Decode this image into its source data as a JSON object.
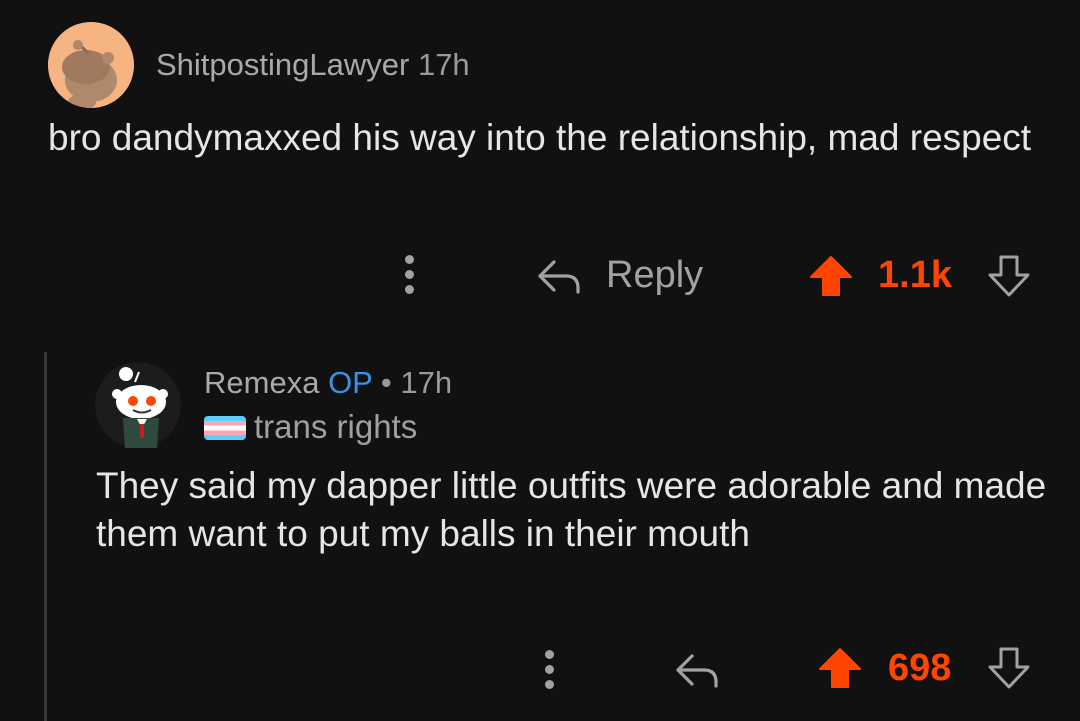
{
  "comments": [
    {
      "username": "ShitpostingLawyer",
      "time": "17h",
      "body": "bro dandymaxxed his way into the relationship, mad respect",
      "reply_label": "Reply",
      "score": "1.1k",
      "avatar_icon": "snoo-avatar-orange"
    },
    {
      "username": "Remexa",
      "op_badge": "OP",
      "separator": "•",
      "time": "17h",
      "flair": "trans rights",
      "flair_icon": "trans-flag-icon",
      "body": "They said my dapper little outfits were adorable and made them want to put my balls in their mouth",
      "score": "698",
      "avatar_icon": "snoo-avatar-dark"
    }
  ],
  "colors": {
    "background": "#111112",
    "upvote_active": "#ff4500",
    "op_badge": "#3a91e8",
    "muted_text": "#9a9a9a",
    "thread_line": "#3a3a3a"
  }
}
